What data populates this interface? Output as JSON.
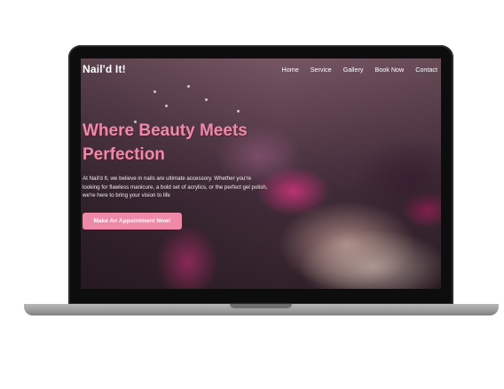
{
  "site": {
    "logo": "Nail'd It!"
  },
  "nav": {
    "items": [
      {
        "label": "Home"
      },
      {
        "label": "Service"
      },
      {
        "label": "Gallery"
      },
      {
        "label": "Book Now"
      },
      {
        "label": "Contact"
      }
    ]
  },
  "hero": {
    "title_line1": "Where Beauty Meets",
    "title_line2": "Perfection",
    "description_line1": "At Nail'd It, we believe in nails are ultimate accessory. Whether you're",
    "description_line2": "looking for flawless manicure, a bold set of acrylics, or the perfect gel polish,",
    "description_line3": "we're here to bring your vision to life",
    "cta_label": "Make An Appointment Now!"
  },
  "colors": {
    "accent": "#ee8aa8",
    "nav_text": "#ffffff",
    "laptop_bezel": "#0d0d0d",
    "laptop_base": "#9a9a9a"
  }
}
